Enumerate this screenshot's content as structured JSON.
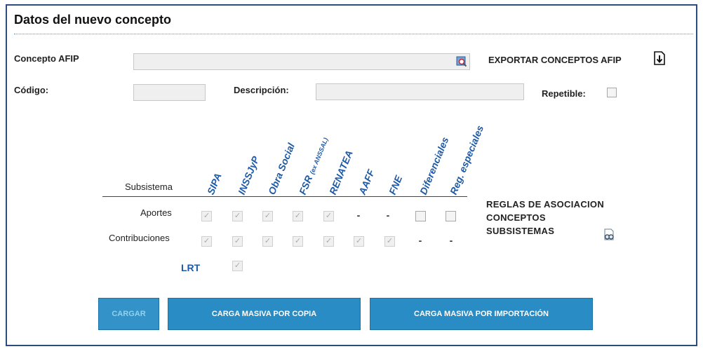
{
  "form": {
    "title": "Datos del nuevo concepto",
    "concepto_afip_label": "Concepto AFIP",
    "concepto_afip_value": "",
    "exportar_label": "EXPORTAR CONCEPTOS AFIP",
    "codigo_label": "Código:",
    "codigo_value": "",
    "descripcion_label": "Descripción:",
    "descripcion_value": "",
    "repetible_label": "Repetible:"
  },
  "table": {
    "header_label": "Subsistema",
    "columns": [
      "SIPA",
      "INSSJyP",
      "Obra Social",
      "FSR",
      "RENATEA",
      "AAFF",
      "FNE",
      "Diferenciales",
      "Reg. especiales"
    ],
    "fsr_suffix": "(ex ANSSAL)",
    "rows": {
      "aportes": "Aportes",
      "contribuciones": "Contribuciones",
      "lrt": "LRT"
    },
    "dash": "-"
  },
  "reglas": {
    "line1": "REGLAS DE ASOCIACION",
    "line2": "CONCEPTOS",
    "line3": "SUBSISTEMAS"
  },
  "buttons": {
    "cargar": "CARGAR",
    "carga_copia": "CARGA MASIVA POR COPIA",
    "carga_importacion": "CARGA MASIVA POR IMPORTACIÓN"
  },
  "icons": {
    "lookup": "magnifier-icon",
    "export": "download-icon",
    "reglas": "glasses-view-icon"
  },
  "colors": {
    "border": "#2b4c7e",
    "accent": "#1f5aa6",
    "button": "#2a8cc5"
  }
}
